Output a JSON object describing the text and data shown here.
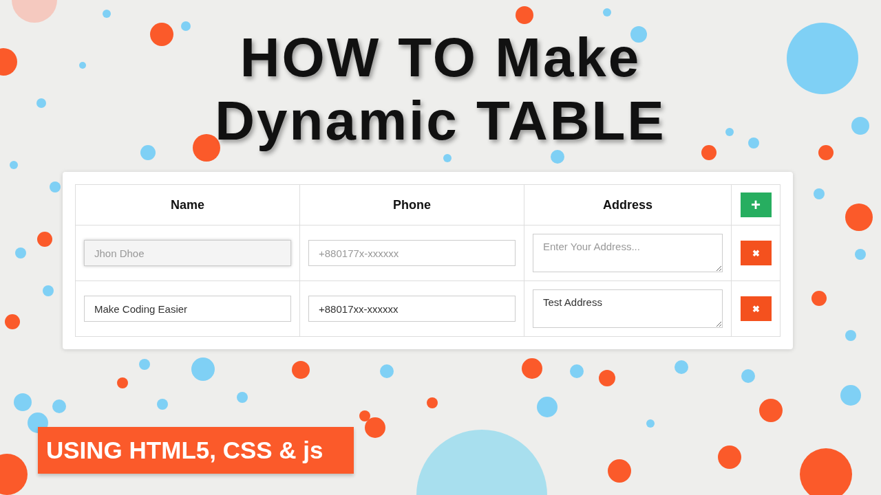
{
  "title": [
    "HOW TO Make",
    "Dynamic TABLE"
  ],
  "table": {
    "columns": [
      "Name",
      "Phone",
      "Address"
    ],
    "add_button": "+",
    "rows": [
      {
        "name": {
          "placeholder": "Jhon Dhoe",
          "focused": true
        },
        "phone": {
          "placeholder": "+880177x-xxxxxx",
          "focused": false
        },
        "address": {
          "placeholder": "Enter Your Address...",
          "focused": false
        },
        "remove_button": "✖"
      },
      {
        "name": {
          "value": "Make Coding Easier",
          "focused": false
        },
        "phone": {
          "value": "+88017xx-xxxxxx",
          "focused": false
        },
        "address": {
          "value": "Test Address",
          "focused": false
        },
        "remove_button": "✖"
      }
    ]
  },
  "banner": "USING HTML5, CSS & js"
}
